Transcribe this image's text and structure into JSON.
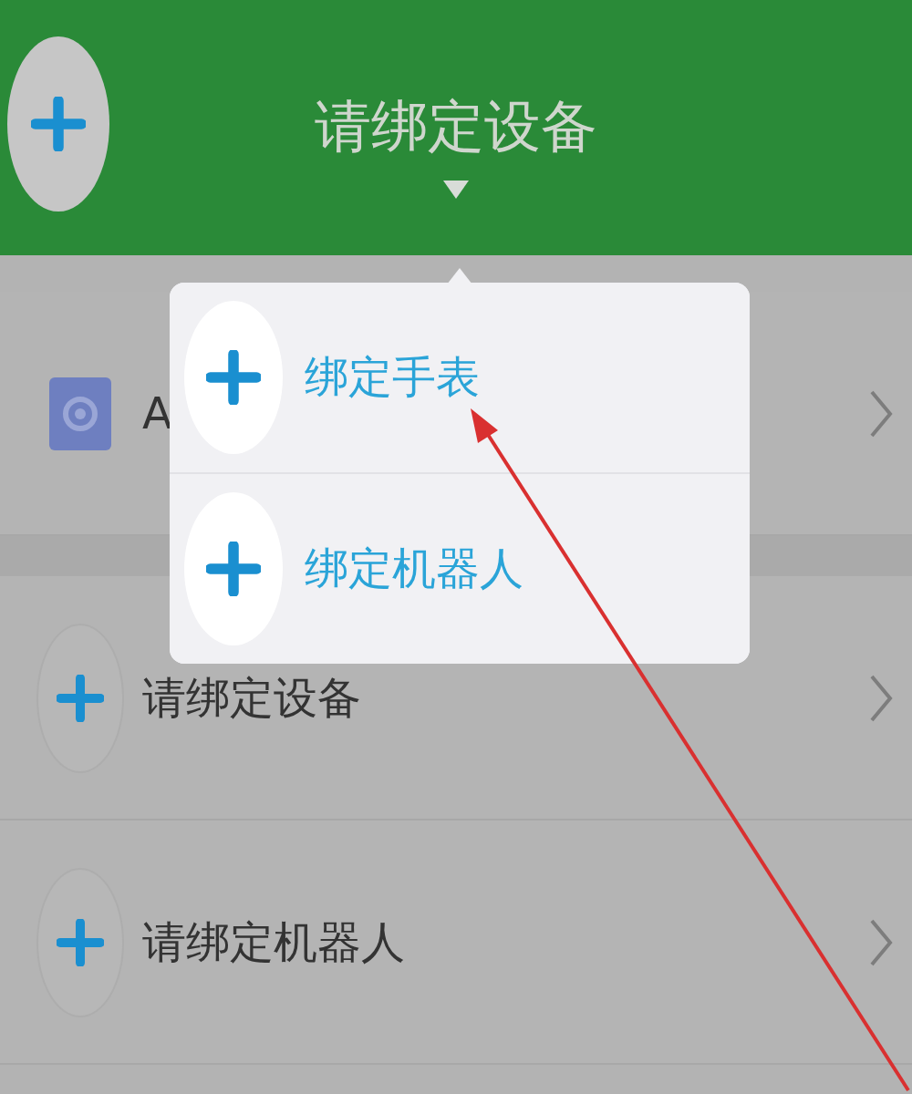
{
  "header": {
    "title": "请绑定设备"
  },
  "rows": [
    {
      "kind": "settings",
      "label": "A"
    },
    {
      "kind": "add",
      "label": "请绑定设备"
    },
    {
      "kind": "add",
      "label": "请绑定机器人"
    }
  ],
  "popup_menu": {
    "items": [
      {
        "label": "绑定手表"
      },
      {
        "label": "绑定机器人"
      }
    ]
  }
}
